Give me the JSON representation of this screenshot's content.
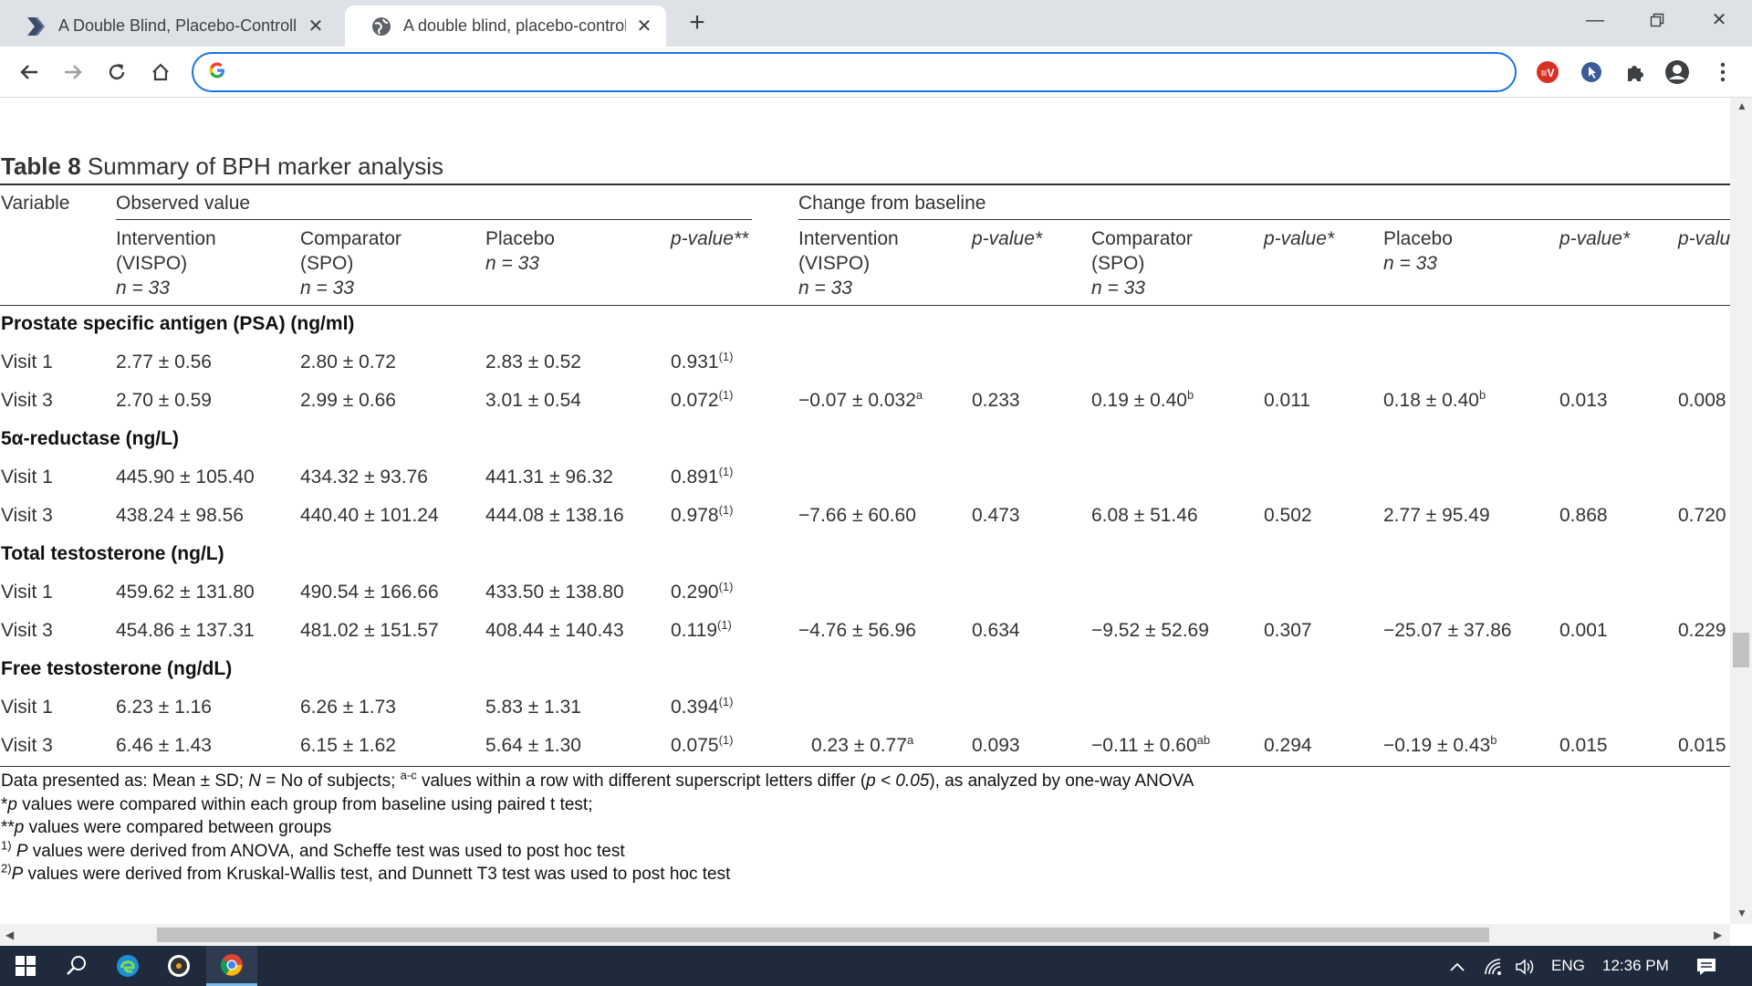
{
  "browser": {
    "tabs": [
      {
        "title": "A Double Blind, Placebo-Controll",
        "icon": "bookmark-arrow-icon",
        "active": false
      },
      {
        "title": "A double blind, placebo-controlle",
        "icon": "globe-icon",
        "active": true
      }
    ],
    "new_tab": "+",
    "omnibox_value": "",
    "omnibox_placeholder": ""
  },
  "table": {
    "caption_bold": "Table 8",
    "caption_text": " Summary of BPH marker analysis",
    "headers": {
      "variable": "Variable",
      "observed": "Observed value",
      "change": "Change from baseline",
      "obs_intervention": [
        "Intervention",
        "(VISPO)",
        "n = 33"
      ],
      "obs_comparator": [
        "Comparator",
        "(SPO)",
        "n = 33"
      ],
      "obs_placebo": [
        "Placebo",
        "n = 33"
      ],
      "obs_pvalue": "p-value**",
      "chg_intervention": [
        "Intervention",
        "(VISPO)",
        "n = 33"
      ],
      "chg_p1": "p-value*",
      "chg_comparator": [
        "Comparator",
        "(SPO)",
        "n = 33"
      ],
      "chg_p2": "p-value*",
      "chg_placebo": [
        "Placebo",
        "n = 33"
      ],
      "chg_p3": "p-value*",
      "chg_p4": "p-valu"
    },
    "sections": [
      {
        "title": "Prostate specific antigen (PSA) (ng/ml)",
        "rows": [
          {
            "label": "Visit 1",
            "vispo": "2.77 ± 0.56",
            "spo": "2.80 ± 0.72",
            "placebo": "2.83 ± 0.52",
            "p": "0.931",
            "p_sup": "(1)",
            "c_vispo": "",
            "c_vispo_sup": "",
            "c_p1": "",
            "c_spo": "",
            "c_spo_sup": "",
            "c_p2": "",
            "c_pl": "",
            "c_pl_sup": "",
            "c_p3": "",
            "c_p4": ""
          },
          {
            "label": "Visit 3",
            "vispo": "2.70 ± 0.59",
            "spo": "2.99 ± 0.66",
            "placebo": "3.01 ± 0.54",
            "p": "0.072",
            "p_sup": "(1)",
            "c_vispo": "−0.07 ± 0.032",
            "c_vispo_sup": "a",
            "c_p1": "0.233",
            "c_spo": "0.19 ± 0.40",
            "c_spo_sup": "b",
            "c_p2": "0.011",
            "c_pl": "0.18 ± 0.40",
            "c_pl_sup": "b",
            "c_p3": "0.013",
            "c_p4": "0.008"
          }
        ]
      },
      {
        "title": "5α-reductase (ng/L)",
        "rows": [
          {
            "label": "Visit 1",
            "vispo": "445.90 ± 105.40",
            "spo": "434.32 ± 93.76",
            "placebo": "441.31 ± 96.32",
            "p": "0.891",
            "p_sup": "(1)",
            "c_vispo": "",
            "c_vispo_sup": "",
            "c_p1": "",
            "c_spo": "",
            "c_spo_sup": "",
            "c_p2": "",
            "c_pl": "",
            "c_pl_sup": "",
            "c_p3": "",
            "c_p4": ""
          },
          {
            "label": "Visit 3",
            "vispo": "438.24 ± 98.56",
            "spo": "440.40 ± 101.24",
            "placebo": "444.08 ± 138.16",
            "p": "0.978",
            "p_sup": "(1)",
            "c_vispo": "−7.66 ± 60.60",
            "c_vispo_sup": "",
            "c_p1": "0.473",
            "c_spo": "6.08 ± 51.46",
            "c_spo_sup": "",
            "c_p2": "0.502",
            "c_pl": "2.77 ± 95.49",
            "c_pl_sup": "",
            "c_p3": "0.868",
            "c_p4": "0.720"
          }
        ]
      },
      {
        "title": "Total testosterone (ng/L)",
        "rows": [
          {
            "label": "Visit 1",
            "vispo": "459.62 ± 131.80",
            "spo": "490.54 ± 166.66",
            "placebo": "433.50 ± 138.80",
            "p": "0.290",
            "p_sup": "(1)",
            "c_vispo": "",
            "c_vispo_sup": "",
            "c_p1": "",
            "c_spo": "",
            "c_spo_sup": "",
            "c_p2": "",
            "c_pl": "",
            "c_pl_sup": "",
            "c_p3": "",
            "c_p4": ""
          },
          {
            "label": "Visit 3",
            "vispo": "454.86 ± 137.31",
            "spo": "481.02 ± 151.57",
            "placebo": "408.44 ± 140.43",
            "p": "0.119",
            "p_sup": "(1)",
            "c_vispo": "−4.76 ± 56.96",
            "c_vispo_sup": "",
            "c_p1": "0.634",
            "c_spo": "−9.52 ± 52.69",
            "c_spo_sup": "",
            "c_p2": "0.307",
            "c_pl": "−25.07 ± 37.86",
            "c_pl_sup": "",
            "c_p3": "0.001",
            "c_p4": "0.229"
          }
        ]
      },
      {
        "title": "Free testosterone (ng/dL)",
        "rows": [
          {
            "label": "Visit 1",
            "vispo": "6.23 ± 1.16",
            "spo": "6.26 ± 1.73",
            "placebo": "5.83 ± 1.31",
            "p": "0.394",
            "p_sup": "(1)",
            "c_vispo": "",
            "c_vispo_sup": "",
            "c_p1": "",
            "c_spo": "",
            "c_spo_sup": "",
            "c_p2": "",
            "c_pl": "",
            "c_pl_sup": "",
            "c_p3": "",
            "c_p4": ""
          },
          {
            "label": "Visit 3",
            "vispo": "6.46 ± 1.43",
            "spo": "6.15 ± 1.62",
            "placebo": "5.64 ± 1.30",
            "p": "0.075",
            "p_sup": "(1)",
            "c_vispo": "0.23 ± 0.77",
            "c_vispo_sup": "a",
            "c_p1": "0.093",
            "c_spo": "−0.11 ± 0.60",
            "c_spo_sup": "ab",
            "c_p2": "0.294",
            "c_pl": "−0.19 ± 0.43",
            "c_pl_sup": "b",
            "c_p3": "0.015",
            "c_p4": "0.015"
          }
        ]
      }
    ],
    "footnotes": {
      "line1_a": "Data presented as: Mean ± SD; ",
      "line1_N": "N",
      "line1_b": " = No of subjects; ",
      "line1_sup": "a-c",
      "line1_c": " values within a row with different superscript letters differ (",
      "line1_p": "p < 0.05",
      "line1_d": "), as analyzed by one-way ANOVA",
      "line2_a": "*",
      "line2_p": "p",
      "line2_b": " values were compared within each group from baseline using paired t test;",
      "line3_a": "**",
      "line3_p": "p",
      "line3_b": " values were compared between groups",
      "line4_sup": "1)",
      "line4_P": " P",
      "line4_b": " values were derived from ANOVA, and Scheffe test was used to post hoc test",
      "line5_sup": "2)",
      "line5_P": "P",
      "line5_b": " values were derived from Kruskal-Wallis test, and Dunnett T3 test was used to post hoc test"
    }
  },
  "taskbar": {
    "language": "ENG",
    "time": "12:36 PM"
  },
  "colors": {
    "tabbar": "#dee1e6",
    "omnibox_border": "#1a73e8",
    "taskbar": "#1f2a3c",
    "ext_red": "#d93025",
    "ext_blue": "#3c5a99"
  }
}
